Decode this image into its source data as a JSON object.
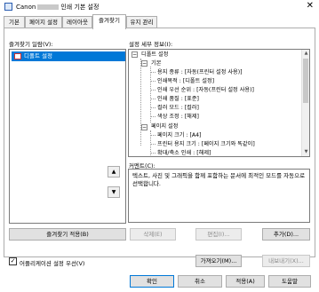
{
  "window": {
    "app": "Canon",
    "title_suffix": "인쇄 기본 설정",
    "close": "✕"
  },
  "tabs": [
    {
      "label": "기본"
    },
    {
      "label": "페이지 설정"
    },
    {
      "label": "레이아웃"
    },
    {
      "label": "즐겨찾기"
    },
    {
      "label": "유지 관리"
    }
  ],
  "favorites": {
    "list_label": "즐겨찾기 일람(V):",
    "items": [
      {
        "label": "디폴트 설정"
      }
    ],
    "apply_button": "즐겨찾기 적용(B)"
  },
  "details": {
    "label": "설정 세부 정보(I):",
    "tree": [
      {
        "text": "디폴트 설정",
        "level": 0,
        "toggle": "−"
      },
      {
        "text": "기본",
        "level": 1,
        "toggle": "−"
      },
      {
        "text": "용지 종류 : [자동(프린터 설정 사용)]",
        "level": 2
      },
      {
        "text": "인쇄목적 : [디폴트 설정]",
        "level": 2
      },
      {
        "text": "인쇄 우선 순위 : [자동(프린터 설정 사용)]",
        "level": 2
      },
      {
        "text": "인쇄 품질 : [표준]",
        "level": 2
      },
      {
        "text": "컬러 모드 : [컬러]",
        "level": 2
      },
      {
        "text": "색상 조정 : [해제]",
        "level": 2
      },
      {
        "text": "페이지 설정",
        "level": 1,
        "toggle": "−"
      },
      {
        "text": "페이지 크기 : [A4]",
        "level": 2
      },
      {
        "text": "프린터 용지 크기 : [페이지 크기와 똑같이]",
        "level": 2
      },
      {
        "text": "확대/축소 인쇄 : [해제]",
        "level": 2
      }
    ]
  },
  "comment": {
    "label": "커멘트(C):",
    "text": "텍스트, 사진 및 그래픽을 함께 포함하는 문서에 최적인 모드를 자동으로 선택합니다."
  },
  "side_buttons": {
    "up": "▲",
    "down": "▼"
  },
  "buttons": {
    "delete": "삭제(E)",
    "edit": "편집(I)...",
    "add": "추가(D)...",
    "import": "가져오기(M)...",
    "export": "내보내기(X)...",
    "ok": "확인",
    "cancel": "취소",
    "apply": "적용(A)",
    "help": "도움말"
  },
  "app_checkbox": {
    "label": "어플리케이션 설정 우선(V)",
    "checked": true,
    "mark": "✓"
  }
}
